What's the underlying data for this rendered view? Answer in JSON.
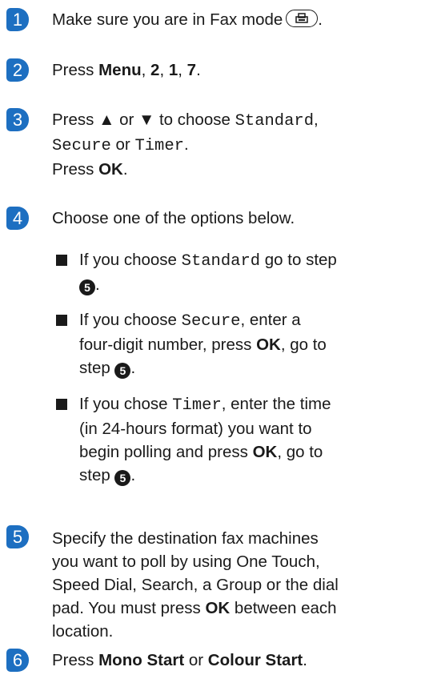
{
  "steps": [
    {
      "num": "1",
      "text_pre": "Make sure you are in Fax mode",
      "text_post": "."
    },
    {
      "num": "2",
      "press": "Press",
      "k1": "Menu",
      "c1": ",",
      "k2": "2",
      "c2": ",",
      "k3": "1",
      "c3": ",",
      "k4": "7",
      "end": "."
    },
    {
      "num": "3",
      "press": "Press ▲ or ▼ to choose",
      "opt1": "Standard",
      "comma": ",",
      "opt2": "Secure",
      "or": "or",
      "opt3": "Timer",
      "dot": ".",
      "press2": "Press",
      "ok": "OK",
      "dot2": "."
    },
    {
      "num": "4",
      "text": "Choose one of the options below."
    },
    {
      "num": "5",
      "line1": "Specify the destination fax machines",
      "line2": "you want to poll by using One Touch,",
      "line3": "Speed Dial, Search, a Group or the dial",
      "line4_pre": "pad. You must press",
      "line4_key": "OK",
      "line4_post": "between each",
      "line5": "location."
    },
    {
      "num": "6",
      "press": "Press",
      "k1": "Mono Start",
      "or": "or",
      "k2": "Colour Start",
      "end": "."
    }
  ],
  "options": [
    {
      "pre": "If you choose",
      "opt": "Standard",
      "post": "go to step",
      "ref": "5",
      "end": "."
    },
    {
      "pre": "If you choose",
      "opt": "Secure",
      "post": ", enter a",
      "line2_pre": "four-digit number, press",
      "line2_key": "OK",
      "line2_post": ", go to",
      "line3_pre": "step",
      "ref": "5",
      "end": "."
    },
    {
      "pre": "If you chose",
      "opt": "Timer",
      "post": ", enter the time",
      "line2": "(in 24-hours format) you want to",
      "line3_pre": "begin polling and press",
      "line3_key": "OK",
      "line3_post": ", go to",
      "line4_pre": "step",
      "ref": "5",
      "end": "."
    }
  ],
  "icons": {
    "fax_key": "fax-mode-key-icon",
    "bullet": "square-bullet"
  },
  "colors": {
    "badge": "#1d6fc1"
  }
}
